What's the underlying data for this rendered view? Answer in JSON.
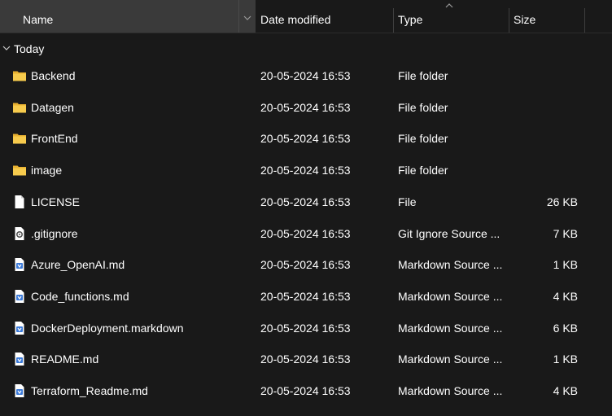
{
  "header": {
    "name_label": "Name",
    "date_label": "Date modified",
    "type_label": "Type",
    "size_label": "Size"
  },
  "group": {
    "label": "Today"
  },
  "rows": [
    {
      "name": "Backend",
      "date": "20-05-2024 16:53",
      "type": "File folder",
      "size": "",
      "icon": "folder-icon"
    },
    {
      "name": "Datagen",
      "date": "20-05-2024 16:53",
      "type": "File folder",
      "size": "",
      "icon": "folder-icon"
    },
    {
      "name": "FrontEnd",
      "date": "20-05-2024 16:53",
      "type": "File folder",
      "size": "",
      "icon": "folder-icon"
    },
    {
      "name": "image",
      "date": "20-05-2024 16:53",
      "type": "File folder",
      "size": "",
      "icon": "folder-icon"
    },
    {
      "name": "LICENSE",
      "date": "20-05-2024 16:53",
      "type": "File",
      "size": "26 KB",
      "icon": "file-icon"
    },
    {
      "name": ".gitignore",
      "date": "20-05-2024 16:53",
      "type": "Git Ignore Source ...",
      "size": "7 KB",
      "icon": "settings-file-icon"
    },
    {
      "name": "Azure_OpenAI.md",
      "date": "20-05-2024 16:53",
      "type": "Markdown Source ...",
      "size": "1 KB",
      "icon": "markdown-file-icon"
    },
    {
      "name": "Code_functions.md",
      "date": "20-05-2024 16:53",
      "type": "Markdown Source ...",
      "size": "4 KB",
      "icon": "markdown-file-icon"
    },
    {
      "name": "DockerDeployment.markdown",
      "date": "20-05-2024 16:53",
      "type": "Markdown Source ...",
      "size": "6 KB",
      "icon": "markdown-file-icon"
    },
    {
      "name": "README.md",
      "date": "20-05-2024 16:53",
      "type": "Markdown Source ...",
      "size": "1 KB",
      "icon": "markdown-file-icon"
    },
    {
      "name": "Terraform_Readme.md",
      "date": "20-05-2024 16:53",
      "type": "Markdown Source ...",
      "size": "4 KB",
      "icon": "markdown-file-icon"
    }
  ],
  "colors": {
    "background": "#191919",
    "header_active": "#3a3a3a",
    "folder": "#f4c442",
    "markdown_badge": "#3b7ad9"
  }
}
